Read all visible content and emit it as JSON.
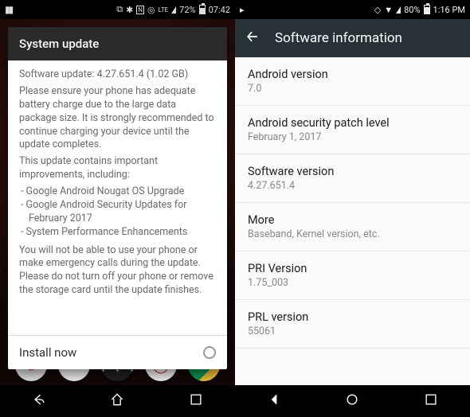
{
  "left": {
    "status": {
      "battery": "72%",
      "time": "07:42",
      "net": "LTE"
    },
    "dialog": {
      "title": "System update",
      "line1": "Software update: 4.27.651.4 (1.02 GB)",
      "para1": "Please ensure your phone has adequate battery charge due to the large data package size. It is strongly recommended to continue charging your device until the update completes.",
      "intro2": "This update contains important improvements, including:",
      "items": [
        "-  Google Android Nougat OS Upgrade",
        "-  Google Android Security Updates for February 2017",
        "-  System Performance Enhancements"
      ],
      "para2": "You will not be able to use your phone or make emergency calls during the update. Please do not turn off your phone or remove the storage card until the update finishes.",
      "action": "Install now"
    }
  },
  "right": {
    "status": {
      "battery": "80%",
      "time": "1:16 PM"
    },
    "appbar": {
      "title": "Software information"
    },
    "items": [
      {
        "title": "Android version",
        "sub": "7.0"
      },
      {
        "title": "Android security patch level",
        "sub": "February 1, 2017"
      },
      {
        "title": "Software version",
        "sub": "4.27.651.4"
      },
      {
        "title": "More",
        "sub": "Baseband, Kernel version, etc."
      },
      {
        "title": "PRI Version",
        "sub": "1.75_003"
      },
      {
        "title": "PRL version",
        "sub": "55061"
      }
    ]
  }
}
